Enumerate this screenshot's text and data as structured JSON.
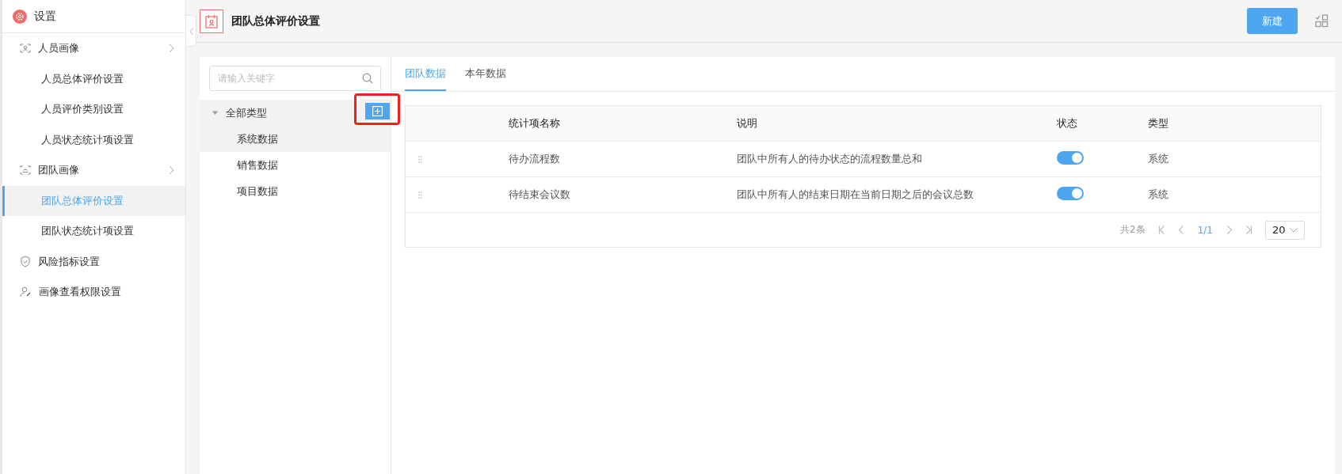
{
  "app": {
    "title": "设置"
  },
  "sidebar": {
    "items": [
      {
        "label": "人员画像",
        "kind": "group",
        "expanded": true,
        "selected": false,
        "children": [
          {
            "label": "人员总体评价设置",
            "selected": false
          },
          {
            "label": "人员评价类别设置",
            "selected": false
          },
          {
            "label": "人员状态统计项设置",
            "selected": false
          }
        ]
      },
      {
        "label": "团队画像",
        "kind": "group",
        "expanded": true,
        "selected": false,
        "children": [
          {
            "label": "团队总体评价设置",
            "selected": true
          },
          {
            "label": "团队状态统计项设置",
            "selected": false
          }
        ]
      },
      {
        "label": "风险指标设置",
        "kind": "link",
        "selected": false
      },
      {
        "label": "画像查看权限设置",
        "kind": "link",
        "selected": false
      }
    ]
  },
  "page": {
    "title": "团队总体评价设置",
    "new_button": "新建"
  },
  "tree": {
    "search": {
      "placeholder": "请输入关键字"
    },
    "add_button": {
      "highlighted": true
    },
    "root": {
      "label": "全部类型",
      "expanded": true,
      "hovered": true,
      "children": [
        {
          "label": "系统数据",
          "selected": true
        },
        {
          "label": "销售数据",
          "selected": false
        },
        {
          "label": "项目数据",
          "selected": false
        }
      ]
    }
  },
  "tabs": [
    {
      "label": "团队数据",
      "selected": true
    },
    {
      "label": "本年数据",
      "selected": false
    }
  ],
  "table": {
    "columns": [
      "统计项名称",
      "说明",
      "状态",
      "类型"
    ],
    "rows": [
      {
        "name": "待办流程数",
        "description": "团队中所有人的待办状态的流程数量总和",
        "on": true,
        "type": "系统"
      },
      {
        "name": "待结束会议数",
        "description": "团队中所有人的结束日期在当前日期之后的会议总数",
        "on": true,
        "type": "系统"
      }
    ]
  },
  "pagination": {
    "total": "共2条",
    "page": "1/1",
    "page_size": "20"
  }
}
